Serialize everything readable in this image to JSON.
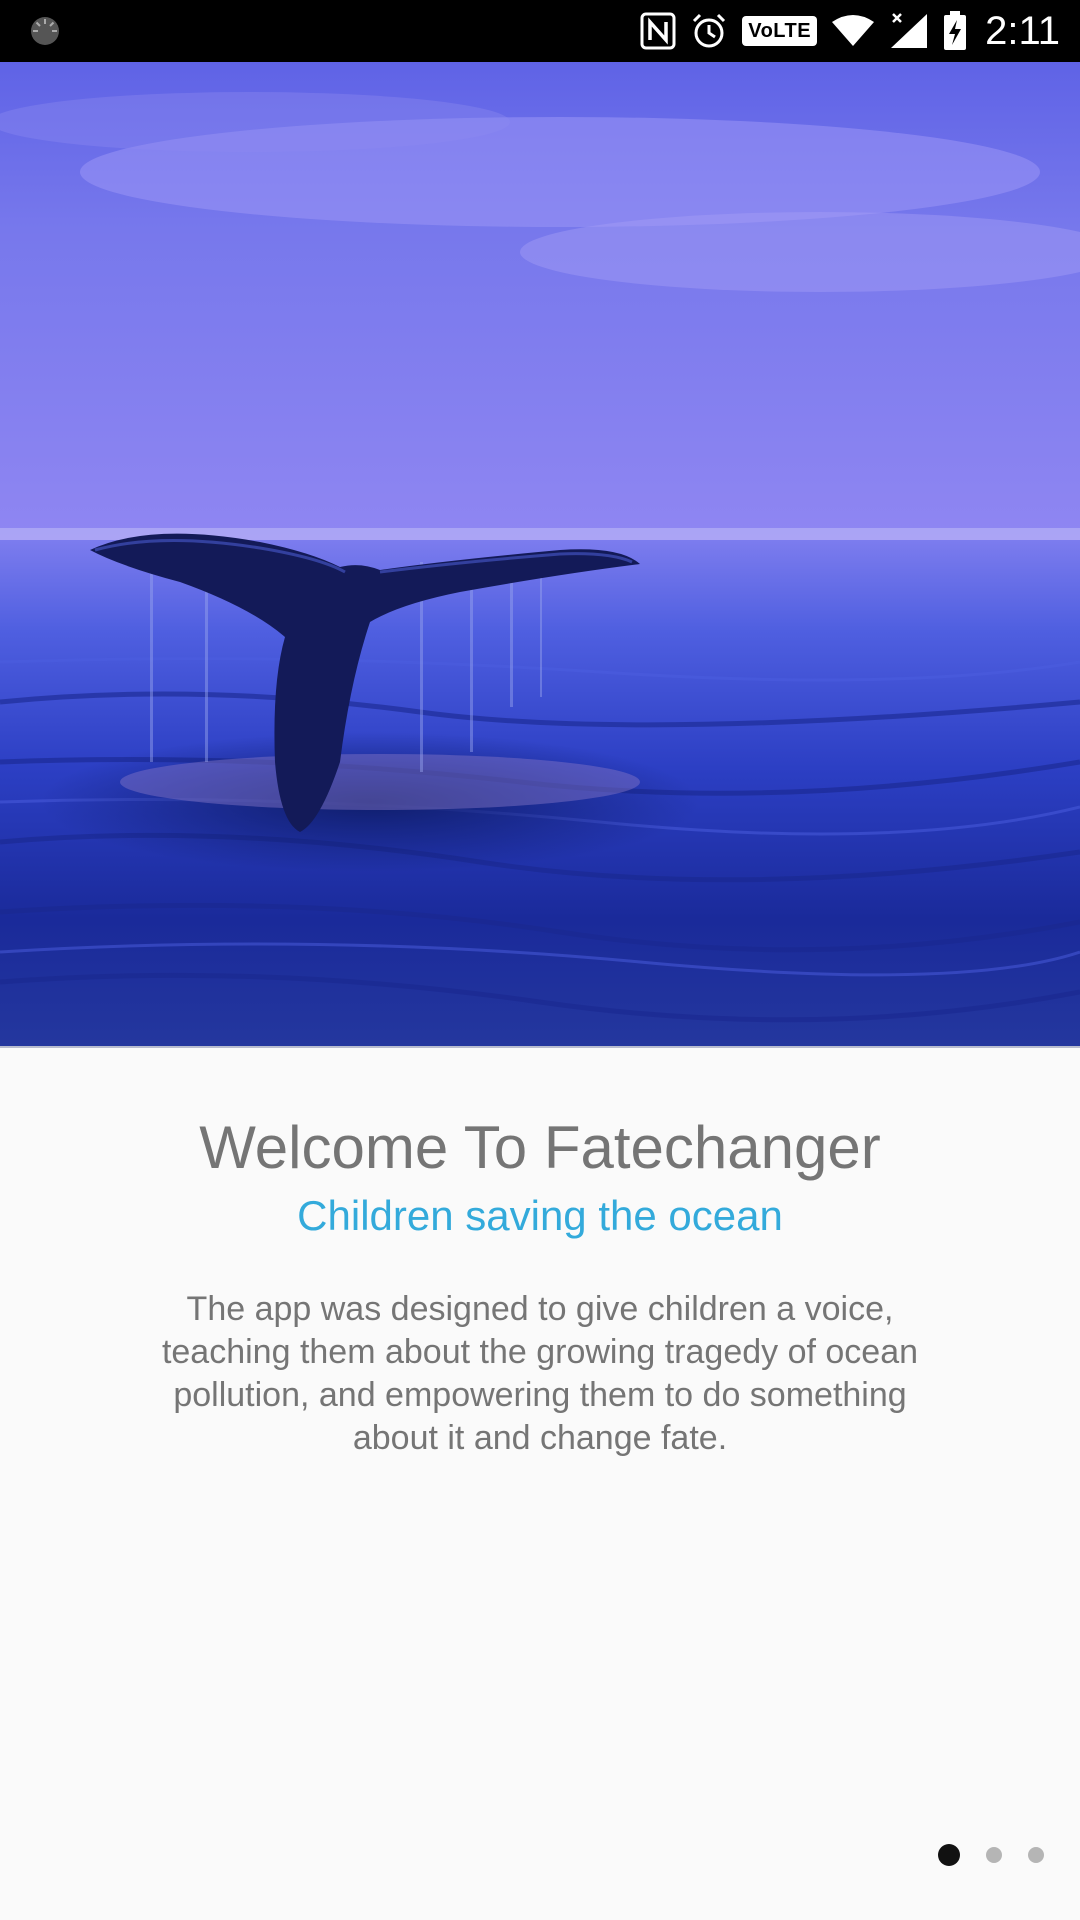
{
  "status_bar": {
    "time": "2:11",
    "volte_label": "VoLTE",
    "icons": [
      "loading-icon",
      "nfc-icon",
      "alarm-icon",
      "volte-icon",
      "wifi-icon",
      "cellular-signal-icon",
      "battery-charging-icon"
    ]
  },
  "hero": {
    "image_description_icon": "whale-tail-image"
  },
  "onboarding": {
    "title": "Welcome To Fatechanger",
    "subtitle": "Children saving the ocean",
    "description": "The app was designed to give children a voice, teaching them about the growing tragedy of ocean pollution, and empowering them to do something about it and change fate."
  },
  "pager": {
    "page_count": 3,
    "active_index": 0
  },
  "colors": {
    "title": "#757575",
    "subtitle": "#33aadb",
    "background": "#fafafa",
    "dot_active": "#111111",
    "dot_inactive": "#b5b5b5"
  }
}
